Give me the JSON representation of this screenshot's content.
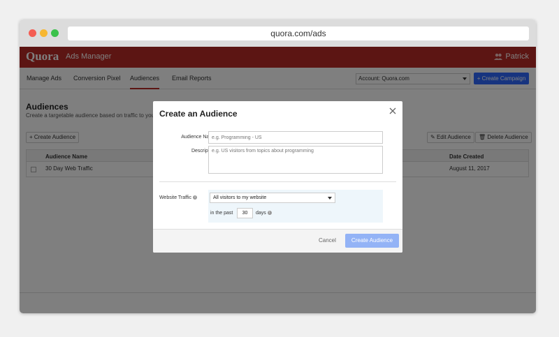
{
  "browser": {
    "url": "quora.com/ads"
  },
  "header": {
    "logo": "Quora",
    "app_name": "Ads Manager",
    "user_name": "Patrick"
  },
  "nav": {
    "tabs": [
      {
        "label": "Manage Ads"
      },
      {
        "label": "Conversion Pixel"
      },
      {
        "label": "Audiences"
      },
      {
        "label": "Email Reports"
      }
    ],
    "active_tab": "Audiences",
    "account_select": "Account: Quora.com",
    "create_campaign": "+ Create Campaign"
  },
  "audiences": {
    "title": "Audiences",
    "subtitle": "Create a targetable audience based on traffic to your w",
    "create_button": "+ Create Audience",
    "edit_button": "Edit Audience",
    "delete_button": "Delete Audience",
    "table": {
      "columns": [
        "Audience Name",
        "Date Created"
      ],
      "rows": [
        {
          "name": "30 Day Web Traffic",
          "date": "August 11, 2017"
        }
      ]
    }
  },
  "modal": {
    "title": "Create an Audience",
    "audience_name_label": "Audience Name",
    "audience_name_placeholder": "e.g. Programming - US",
    "description_label": "Description",
    "description_placeholder": "e.g. US visitors from topics about programming",
    "website_traffic_label": "Website Traffic",
    "traffic_select": "All visitors to my website",
    "in_the_past": "in the past",
    "days_value": "30",
    "days_label": "days",
    "cancel": "Cancel",
    "create": "Create Audience"
  },
  "colors": {
    "brand": "#b92b27",
    "primary_button": "#2e69ff",
    "disabled_button": "#93b3f6"
  }
}
